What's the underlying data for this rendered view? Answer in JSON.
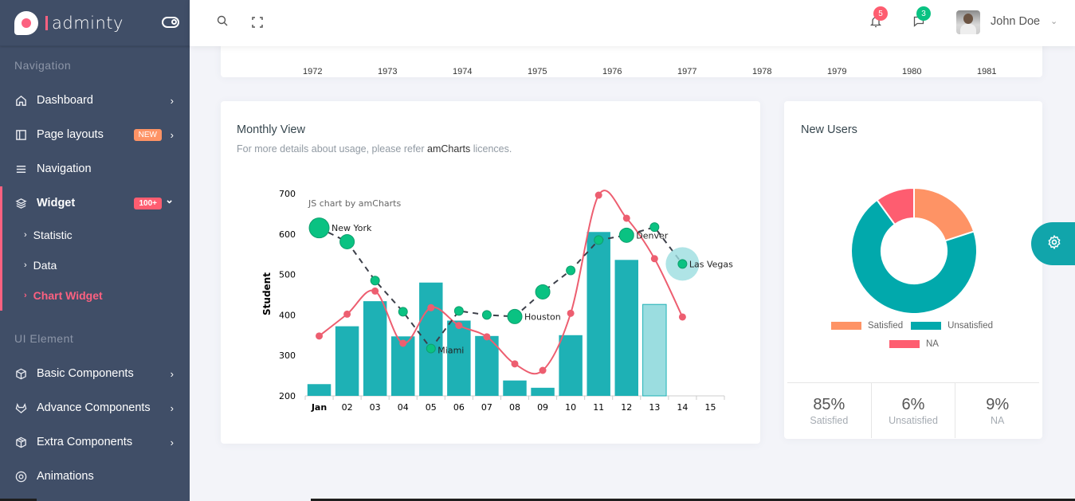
{
  "brand": {
    "name": "adminty"
  },
  "sidebar": {
    "section_navigation": "Navigation",
    "section_ui": "UI Element",
    "items": [
      {
        "label": "Dashboard",
        "icon": "home-icon",
        "chevron": "›"
      },
      {
        "label": "Page layouts",
        "icon": "sidebar-layout-icon",
        "badge": "NEW",
        "badge_color": "#fe9365",
        "chevron": "›"
      },
      {
        "label": "Navigation",
        "icon": "menu-icon"
      },
      {
        "label": "Widget",
        "icon": "layers-icon",
        "badge": "100+",
        "badge_color": "#fe5d70",
        "chevron": "⌄"
      }
    ],
    "sub_items": [
      {
        "label": "Statistic"
      },
      {
        "label": "Data"
      },
      {
        "label": "Chart Widget",
        "active": true
      }
    ],
    "ui_items": [
      {
        "label": "Basic Components",
        "icon": "box-icon",
        "chevron": "›"
      },
      {
        "label": "Advance Components",
        "icon": "gitlab-icon",
        "chevron": "›"
      },
      {
        "label": "Extra Components",
        "icon": "package-icon",
        "chevron": "›"
      },
      {
        "label": "Animations",
        "icon": "aperture-icon"
      }
    ]
  },
  "header": {
    "notifications_count": "5",
    "messages_count": "3",
    "user_name": "John Doe",
    "colors": {
      "notif": "#fe5d70",
      "msg": "#0ac282"
    }
  },
  "top_card": {
    "years": [
      "1972",
      "1973",
      "1974",
      "1975",
      "1976",
      "1977",
      "1978",
      "1979",
      "1980",
      "1981"
    ]
  },
  "monthly_view": {
    "title": "Monthly View",
    "subtitle_pre": "For more details about usage, please refer ",
    "subtitle_link": "amCharts",
    "subtitle_post": " licences.",
    "credit": "JS chart by amCharts"
  },
  "new_users": {
    "title": "New Users",
    "stats": [
      {
        "value": "85%",
        "label": "Satisfied"
      },
      {
        "value": "6%",
        "label": "Unsatisfied"
      },
      {
        "value": "9%",
        "label": "NA"
      }
    ]
  },
  "chart_data": [
    {
      "type": "bar",
      "title": "Monthly View",
      "ylabel": "Student",
      "xlabel": "",
      "ylim": [
        200,
        700
      ],
      "yticks": [
        200,
        300,
        400,
        500,
        600,
        700
      ],
      "categories": [
        "Jan",
        "02",
        "03",
        "04",
        "05",
        "06",
        "07",
        "08",
        "09",
        "10",
        "11",
        "12",
        "13",
        "14",
        "15"
      ],
      "series": [
        {
          "name": "bars",
          "type": "bar",
          "color": "#1eb1b5",
          "values": [
            229,
            372,
            434,
            347,
            480,
            386,
            348,
            238,
            220,
            350,
            605,
            536,
            426,
            null,
            null
          ],
          "light_last_index": 12,
          "light_color": "#9bdde0"
        },
        {
          "name": "smooth-line",
          "type": "line",
          "color": "#ed5e70",
          "values": [
            348,
            402,
            459,
            330,
            418,
            374,
            346,
            279,
            263,
            404,
            696,
            639,
            539,
            395,
            null
          ]
        },
        {
          "name": "bubble-line",
          "type": "line",
          "dashed": true,
          "color": "#0ac282",
          "line_color": "#3c3f49",
          "values": [
            615,
            581,
            485,
            408,
            317,
            410,
            400,
            396,
            457,
            510,
            585,
            597,
            617,
            526,
            null
          ],
          "bubble_sizes": [
            3,
            2,
            1,
            1,
            1,
            1,
            1,
            2,
            2,
            1,
            1,
            2,
            1,
            1,
            null
          ],
          "labels": {
            "0": "New York",
            "4": "Miami",
            "7": "Houston",
            "11": "Denver",
            "13": "Las Vegas"
          }
        }
      ]
    },
    {
      "type": "pie",
      "title": "New Users",
      "donut": true,
      "categories": [
        "Satisfied",
        "Unsatisfied",
        "NA"
      ],
      "values": [
        20,
        70,
        10
      ],
      "colors": [
        "#fe9365",
        "#01a9ac",
        "#fe5d70"
      ],
      "legend": "bottom"
    }
  ]
}
